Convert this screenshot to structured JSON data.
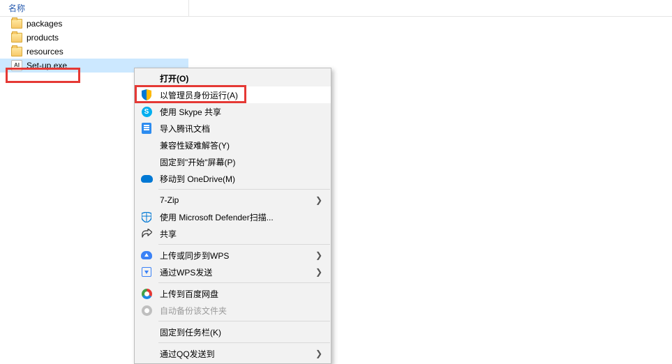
{
  "header": {
    "name_column": "名称"
  },
  "files": {
    "folder1": "packages",
    "folder2": "products",
    "folder3": "resources",
    "exe": "Set-up.exe",
    "exe_icon_text": "AI"
  },
  "menu": {
    "open": "打开(O)",
    "run_as_admin": "以管理员身份运行(A)",
    "skype_share": "使用 Skype 共享",
    "tencent_docs": "导入腾讯文档",
    "compat": "兼容性疑难解答(Y)",
    "pin_start": "固定到\"开始\"屏幕(P)",
    "onedrive": "移动到 OneDrive(M)",
    "seven_zip": "7-Zip",
    "defender": "使用 Microsoft Defender扫描...",
    "share": "共享",
    "wps_upload": "上传或同步到WPS",
    "wps_send": "通过WPS发送",
    "baidu_upload": "上传到百度网盘",
    "baidu_auto": "自动备份该文件夹",
    "pin_taskbar": "固定到任务栏(K)",
    "qq_send": "通过QQ发送到"
  }
}
